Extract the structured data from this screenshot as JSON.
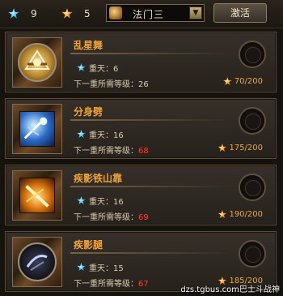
{
  "topbar": {
    "blue_count": "9",
    "orange_count": "5",
    "dropdown_value": "法门三",
    "activate_label": "激活"
  },
  "skills": [
    {
      "name": "乱星舞",
      "tier_label": "重天：6",
      "req_label": "下一重所需等级：",
      "req_level": "26",
      "req_ok": true,
      "cost": "70/200"
    },
    {
      "name": "分身劈",
      "tier_label": "重天：16",
      "req_label": "下一重所需等级：",
      "req_level": "68",
      "req_ok": false,
      "cost": "175/200"
    },
    {
      "name": "疾影铁山靠",
      "tier_label": "重天：16",
      "req_label": "下一重所需等级：",
      "req_level": "69",
      "req_ok": false,
      "cost": "190/200"
    },
    {
      "name": "疾影腿",
      "tier_label": "重天：15",
      "req_label": "下一重所需等级：",
      "req_level": "67",
      "req_ok": false,
      "cost": "185/200"
    }
  ],
  "watermark": "dzs.tgbus.com巴士斗战神",
  "colors": {
    "skill_name": "#f2a43a",
    "level_unmet": "#ff3b2e",
    "cost": "#f0a638"
  }
}
